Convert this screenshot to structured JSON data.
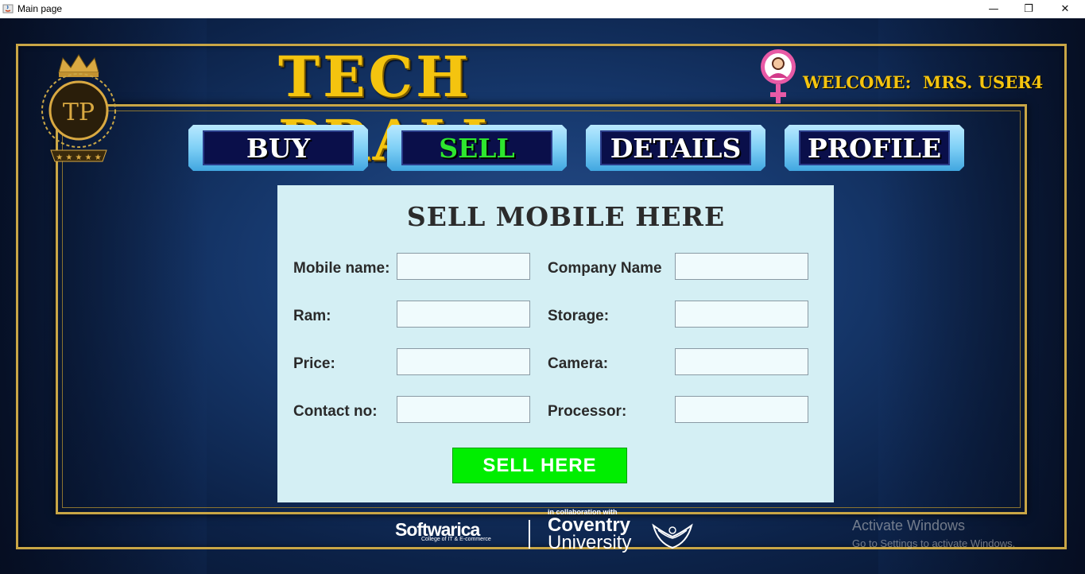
{
  "window": {
    "title": "Main page",
    "minimize_label": "—",
    "maximize_label": "❐",
    "close_label": "✕"
  },
  "header": {
    "brand_title": "TECH PRALI",
    "logo_text": "TP",
    "welcome_text": "WELCOME:  MRS. USER4"
  },
  "nav": {
    "items": [
      {
        "label": "BUY"
      },
      {
        "label": "SELL"
      },
      {
        "label": "DETAILS"
      },
      {
        "label": "PROFILE"
      }
    ],
    "active_color": "#2ee62e"
  },
  "form": {
    "title": "SELL MOBILE HERE",
    "fields": {
      "mobile_name": {
        "label": "Mobile name:",
        "value": ""
      },
      "company_name": {
        "label": "Company Name",
        "value": ""
      },
      "ram": {
        "label": "Ram:",
        "value": ""
      },
      "storage": {
        "label": "Storage:",
        "value": ""
      },
      "price": {
        "label": "Price:",
        "value": ""
      },
      "camera": {
        "label": "Camera:",
        "value": ""
      },
      "contact_no": {
        "label": "Contact no:",
        "value": ""
      },
      "processor": {
        "label": "Processor:",
        "value": ""
      }
    },
    "submit_label": "SELL HERE",
    "submit_color": "#00ee00"
  },
  "footer": {
    "collab_text": "in collaboration with",
    "softwarica": "Softwarica",
    "softwarica_sub": "College of IT & E-commerce",
    "coventry_line1": "Coventry",
    "coventry_line2": "University"
  },
  "watermark": {
    "line1": "Activate Windows",
    "line2": "Go to Settings to activate Windows."
  },
  "colors": {
    "accent_gold": "#f4c40f",
    "panel_bg": "#d4eff4",
    "nav_face": "#0a0f4a"
  }
}
